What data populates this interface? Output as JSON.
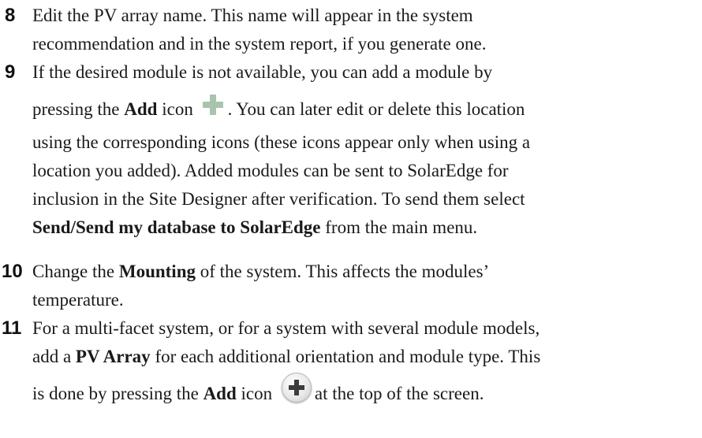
{
  "steps": [
    {
      "number": "8",
      "lines": [
        "Edit the PV array name. This name will appear in the system",
        "recommendation and in the system report, if you generate one."
      ]
    },
    {
      "number": "9",
      "line1": "If the desired module is not available, you can add a module by",
      "line2_pre": "pressing the ",
      "line2_bold": "Add",
      "line2_mid": " icon",
      "line2_post": ". You can later edit or delete this location",
      "line3": "using the corresponding icons (these icons appear only when using a",
      "line4": "location you added). Added modules can be sent to SolarEdge for",
      "line5": "inclusion in the Site Designer after verification. To send them select",
      "line6_bold": "Send/Send my database to SolarEdge",
      "line6_post": " from the main menu."
    },
    {
      "number": "10",
      "line1_pre": "Change the ",
      "line1_bold": "Mounting",
      "line1_post": " of the system. This affects the modules’",
      "line2": "temperature."
    },
    {
      "number": "11",
      "line1": "For a multi-facet system, or for a system with several module models,",
      "line2_pre": "add a ",
      "line2_bold": "PV Array",
      "line2_post": " for each additional orientation and module type. This",
      "line3_pre": "is done by pressing the ",
      "line3_bold": "Add",
      "line3_mid": " icon",
      "line3_post": "at the top of the screen."
    }
  ],
  "icons": {
    "add_flat": "plus-icon",
    "add_round": "add-circle-icon"
  }
}
